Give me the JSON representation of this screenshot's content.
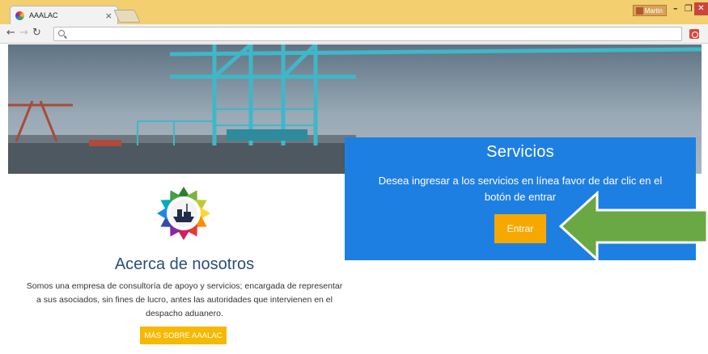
{
  "browser": {
    "tab_title": "AAALAC",
    "tab_close": "×",
    "profile_name": "Martin",
    "address": "",
    "colors": {
      "titlebar": "#f3cf6f",
      "close_btn": "#c9463d"
    }
  },
  "services": {
    "title": "Servicios",
    "description": "Desea ingresar a los servicios en línea favor de dar clic en el botón de entrar",
    "button_label": "Entrar",
    "colors": {
      "panel": "#1e7fe2",
      "button": "#f6a800"
    }
  },
  "annotation": {
    "arrow_color": "#6aa843"
  },
  "about": {
    "title": "Acerca de nosotros",
    "text": "Somos una empresa de consultoría de apoyo y servicios; encargada de representar a sus asociados, sin fines de lucro, antes las autoridades que intervienen en el despacho aduanero.",
    "button_label": "MÁS SOBRE AAALAC",
    "colors": {
      "title": "#2b4d7a",
      "button": "#f6b800"
    }
  }
}
